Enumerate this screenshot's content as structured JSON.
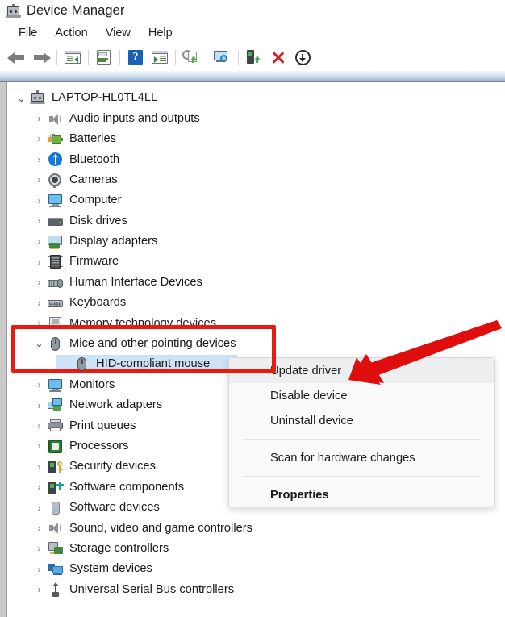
{
  "window": {
    "title": "Device Manager",
    "title_icon": "device-manager-icon"
  },
  "menubar": {
    "items": [
      {
        "label": "File",
        "name": "menu-file"
      },
      {
        "label": "Action",
        "name": "menu-action"
      },
      {
        "label": "View",
        "name": "menu-view"
      },
      {
        "label": "Help",
        "name": "menu-help"
      }
    ]
  },
  "toolbar": {
    "buttons": [
      {
        "name": "back-button",
        "icon": "back-arrow-icon"
      },
      {
        "name": "forward-button",
        "icon": "forward-arrow-icon"
      },
      {
        "name": "show-hide-console-tree-button",
        "icon": "console-tree-icon"
      },
      {
        "name": "properties-button",
        "icon": "properties-document-icon"
      },
      {
        "name": "help-button",
        "icon": "help-question-icon"
      },
      {
        "name": "show-hide-action-pane-button",
        "icon": "action-pane-icon"
      },
      {
        "name": "update-driver-button",
        "icon": "update-driver-gear-icon"
      },
      {
        "name": "scan-for-hardware-changes-button",
        "icon": "scan-monitor-icon"
      },
      {
        "name": "enable-device-button",
        "icon": "enable-device-icon"
      },
      {
        "name": "uninstall-device-button",
        "icon": "red-x-icon"
      },
      {
        "name": "download-button",
        "icon": "download-circle-icon"
      }
    ]
  },
  "tree": {
    "root": {
      "label": "LAPTOP-HL0TL4LL",
      "icon": "laptop-icon",
      "expanded": true
    },
    "items": [
      {
        "label": "Audio inputs and outputs",
        "icon": "speaker-icon",
        "level": 1,
        "expanded": false
      },
      {
        "label": "Batteries",
        "icon": "battery-icon",
        "level": 1,
        "expanded": false
      },
      {
        "label": "Bluetooth",
        "icon": "bluetooth-icon",
        "level": 1,
        "expanded": false
      },
      {
        "label": "Cameras",
        "icon": "camera-icon",
        "level": 1,
        "expanded": false
      },
      {
        "label": "Computer",
        "icon": "computer-monitor-icon",
        "level": 1,
        "expanded": false
      },
      {
        "label": "Disk drives",
        "icon": "disk-drive-icon",
        "level": 1,
        "expanded": false
      },
      {
        "label": "Display adapters",
        "icon": "display-adapter-icon",
        "level": 1,
        "expanded": false
      },
      {
        "label": "Firmware",
        "icon": "firmware-chip-icon",
        "level": 1,
        "expanded": false
      },
      {
        "label": "Human Interface Devices",
        "icon": "human-interface-device-icon",
        "level": 1,
        "expanded": false
      },
      {
        "label": "Keyboards",
        "icon": "keyboard-icon",
        "level": 1,
        "expanded": false
      },
      {
        "label": "Memory technology devices",
        "icon": "memory-technology-icon",
        "level": 1,
        "expanded": false
      },
      {
        "label": "Mice and other pointing devices",
        "icon": "mouse-icon",
        "level": 1,
        "expanded": true
      },
      {
        "label": "HID-compliant mouse",
        "icon": "mouse-icon",
        "level": 2,
        "expanded": null,
        "selected": true
      },
      {
        "label": "Monitors",
        "icon": "computer-monitor-icon",
        "level": 1,
        "expanded": false
      },
      {
        "label": "Network adapters",
        "icon": "network-adapter-icon",
        "level": 1,
        "expanded": false
      },
      {
        "label": "Print queues",
        "icon": "printer-icon",
        "level": 1,
        "expanded": false
      },
      {
        "label": "Processors",
        "icon": "processor-chip-icon",
        "level": 1,
        "expanded": false
      },
      {
        "label": "Security devices",
        "icon": "security-device-key-icon",
        "level": 1,
        "expanded": false
      },
      {
        "label": "Software components",
        "icon": "software-component-icon",
        "level": 1,
        "expanded": false
      },
      {
        "label": "Software devices",
        "icon": "software-device-icon",
        "level": 1,
        "expanded": false
      },
      {
        "label": "Sound, video and game controllers",
        "icon": "speaker-icon",
        "level": 1,
        "expanded": false
      },
      {
        "label": "Storage controllers",
        "icon": "storage-controller-icon",
        "level": 1,
        "expanded": false
      },
      {
        "label": "System devices",
        "icon": "system-device-icon",
        "level": 1,
        "expanded": false
      },
      {
        "label": "Universal Serial Bus controllers",
        "icon": "usb-icon",
        "level": 1,
        "expanded": false
      }
    ],
    "chevron_collapsed": "›",
    "chevron_expanded": "⌄"
  },
  "context_menu": {
    "items": [
      {
        "label": "Update driver",
        "name": "ctx-update-driver",
        "highlighted": true,
        "bold": false
      },
      {
        "label": "Disable device",
        "name": "ctx-disable-device",
        "highlighted": false,
        "bold": false
      },
      {
        "label": "Uninstall device",
        "name": "ctx-uninstall-device",
        "highlighted": false,
        "bold": false
      },
      {
        "separator": true
      },
      {
        "label": "Scan for hardware changes",
        "name": "ctx-scan-for-hardware-changes",
        "highlighted": false,
        "bold": false
      },
      {
        "separator": true
      },
      {
        "label": "Properties",
        "name": "ctx-properties",
        "highlighted": false,
        "bold": true
      }
    ]
  },
  "annotations": {
    "highlight_box_color": "#e81b10",
    "arrow_color": "#e00d0d",
    "selection_color": "#cde3f7"
  }
}
